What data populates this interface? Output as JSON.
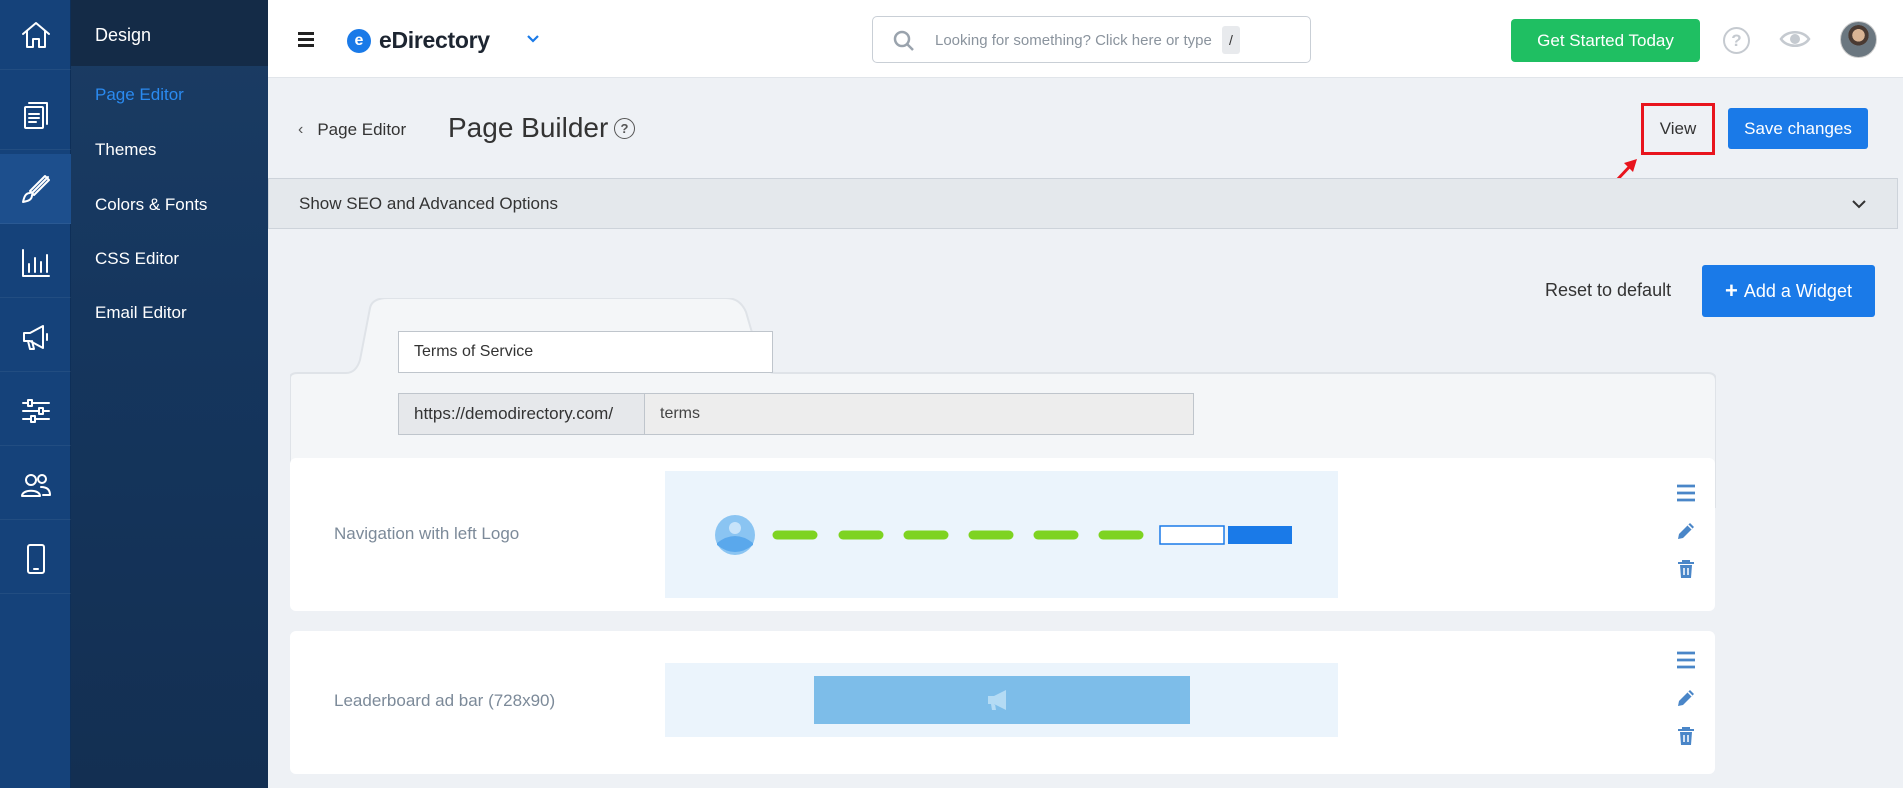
{
  "sidebar": {
    "title": "Design",
    "items": [
      {
        "label": "Page Editor"
      },
      {
        "label": "Themes"
      },
      {
        "label": "Colors & Fonts"
      },
      {
        "label": "CSS Editor"
      },
      {
        "label": "Email Editor"
      }
    ],
    "rail_icons": [
      "home-icon",
      "documents-icon",
      "brush-icon",
      "bar-chart-icon",
      "megaphone-icon",
      "sliders-icon",
      "users-icon",
      "mobile-icon"
    ]
  },
  "header": {
    "brand_letter": "e",
    "brand_name": "eDirectory",
    "search_placeholder": "Looking for something? Click here or type",
    "search_shortcut": "/",
    "cta_label": "Get Started Today",
    "help_symbol": "?"
  },
  "page": {
    "back_label": "Page Editor",
    "title": "Page Builder",
    "help_symbol": "?",
    "view_label": "View",
    "save_label": "Save changes",
    "seo_toggle_label": "Show SEO and Advanced Options",
    "reset_label": "Reset to default",
    "add_widget_label": "Add a Widget",
    "add_widget_symbol": "+",
    "page_name_value": "Terms of Service",
    "url_prefix": "https://demodirectory.com/",
    "url_slug": "terms"
  },
  "widgets": [
    {
      "label": "Navigation with left Logo"
    },
    {
      "label": "Leaderboard ad bar (728x90)"
    }
  ],
  "colors": {
    "accent": "#1a7ae8",
    "cta_green": "#1fbf62",
    "highlight_red": "#e8141d",
    "rail_bg": "#15427a",
    "nav_line_green": "#7ed321"
  }
}
